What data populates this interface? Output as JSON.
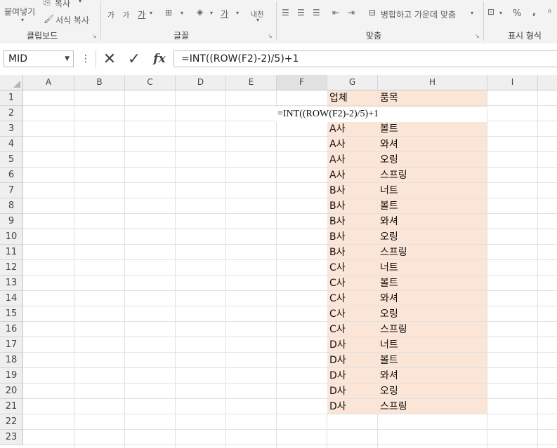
{
  "ribbon": {
    "clipboard": {
      "label": "클립보드",
      "paste_label": "붙여넣기",
      "copy_label": "복사",
      "format_painter_label": "서식 복사"
    },
    "font": {
      "label": "글꼴",
      "increase_size": "가",
      "decrease_size": "가",
      "bold_label": "가",
      "font_color_label": "가",
      "phonetic_label": "내천"
    },
    "alignment": {
      "label": "맞춤",
      "merge_center_label": "병합하고 가운데 맞춤"
    },
    "number": {
      "label": "표시 형식",
      "percent_label": "%",
      "comma_label": ","
    }
  },
  "formula_bar": {
    "name_box": "MID",
    "cancel_icon": "cancel-icon",
    "enter_icon": "enter-icon",
    "fx_label": "fx",
    "formula": "=INT((ROW(F2)-2)/5)+1"
  },
  "columns": [
    "A",
    "B",
    "C",
    "D",
    "E",
    "F",
    "G",
    "H",
    "I"
  ],
  "rows": [
    "1",
    "2",
    "3",
    "4",
    "5",
    "6",
    "7",
    "8",
    "9",
    "10",
    "11",
    "12",
    "13",
    "14",
    "15",
    "16",
    "17",
    "18",
    "19",
    "20",
    "21",
    "22",
    "23"
  ],
  "cells": {
    "G1": "업체",
    "H1": "품목",
    "F2": "=INT((ROW(F2)-2)/5)+1",
    "table": [
      [
        "A사",
        "볼트"
      ],
      [
        "A사",
        "와셔"
      ],
      [
        "A사",
        "오링"
      ],
      [
        "A사",
        "스프링"
      ],
      [
        "B사",
        "너트"
      ],
      [
        "B사",
        "볼트"
      ],
      [
        "B사",
        "와셔"
      ],
      [
        "B사",
        "오링"
      ],
      [
        "B사",
        "스프링"
      ],
      [
        "C사",
        "너트"
      ],
      [
        "C사",
        "볼트"
      ],
      [
        "C사",
        "와셔"
      ],
      [
        "C사",
        "오링"
      ],
      [
        "C사",
        "스프링"
      ],
      [
        "D사",
        "너트"
      ],
      [
        "D사",
        "볼트"
      ],
      [
        "D사",
        "와셔"
      ],
      [
        "D사",
        "오링"
      ],
      [
        "D사",
        "스프링"
      ]
    ]
  },
  "colors": {
    "highlight": "#fbe5d6",
    "header_bg": "#efefef",
    "ribbon_bg": "#f3f3f3"
  }
}
